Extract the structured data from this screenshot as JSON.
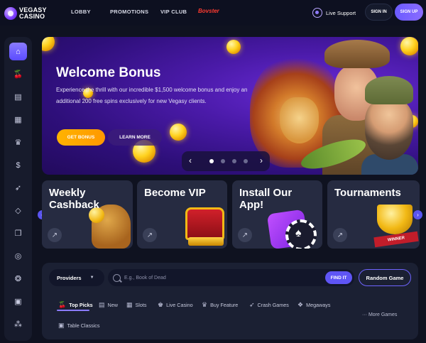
{
  "header": {
    "logo_line1": "VEGASY",
    "logo_line2": "CASINO",
    "nav": [
      "LOBBY",
      "PROMOTIONS",
      "VIP CLUB"
    ],
    "brand_link": "Bovster",
    "live_support": "Live Support",
    "sign_in": "SIGN IN",
    "sign_up": "SIGN UP"
  },
  "sidebar": {
    "items": [
      "home-icon",
      "cherries-icon",
      "slot-machine-icon",
      "calendar-icon",
      "trophy-icon",
      "money-bag-icon",
      "rocket-icon",
      "diamond-icon",
      "documents-icon",
      "roulette-icon",
      "chips-icon",
      "calculator-icon",
      "more-icon"
    ]
  },
  "hero": {
    "title": "Welcome Bonus",
    "text": "Experience the thrill with our incredible $1,500 welcome bonus and enjoy an additional 200 free spins exclusively for new Vegasy clients.",
    "get_bonus": "GET BONUS",
    "learn_more": "LEARN MORE",
    "prev_arrow": "‹",
    "next_arrow": "›",
    "slides_total": 4,
    "slide_active": 1
  },
  "cards": [
    {
      "title": "Weekly Cashback",
      "arrow": "↗"
    },
    {
      "title": "Become VIP",
      "arrow": "↗"
    },
    {
      "title": "Install Our App!",
      "arrow": "↗"
    },
    {
      "title": "Tournaments",
      "arrow": "↗"
    }
  ],
  "card_art": {
    "winner_ribbon": "WINNER"
  },
  "search": {
    "providers_label": "Providers",
    "placeholder": "E.g., Book of Dead",
    "find_it": "FIND IT",
    "random_game": "Random Game"
  },
  "categories": [
    {
      "label": "Top Picks",
      "icon": "🍒"
    },
    {
      "label": "New",
      "icon": "▤"
    },
    {
      "label": "Slots",
      "icon": "▦"
    },
    {
      "label": "Live Casino",
      "icon": "♚"
    },
    {
      "label": "Buy Feature",
      "icon": "♛"
    },
    {
      "label": "Crash Games",
      "icon": "➶"
    },
    {
      "label": "Megaways",
      "icon": "❖"
    }
  ],
  "category_row2": {
    "label": "Table Classics",
    "icon": "▣"
  },
  "more_games": "··· More Games"
}
